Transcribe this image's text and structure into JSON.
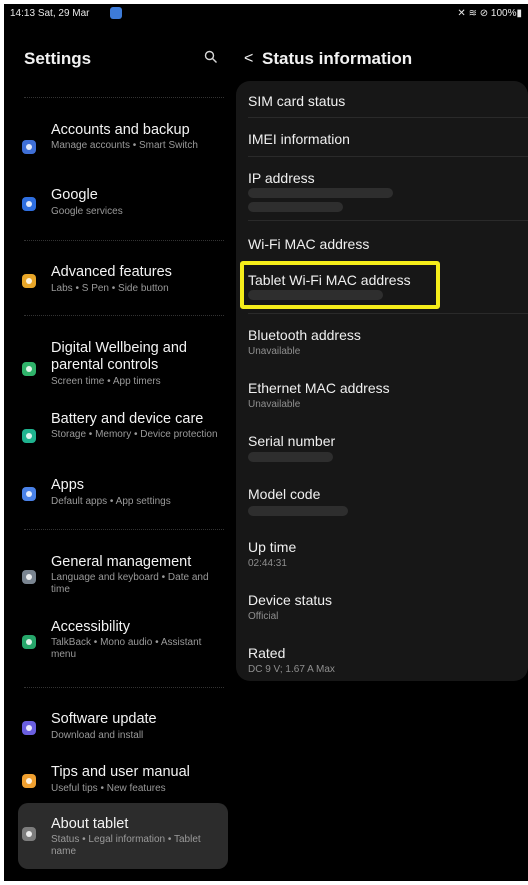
{
  "status_bar": {
    "time": "14:13",
    "date": "Sat, 29 Mar",
    "battery": "100%"
  },
  "left": {
    "title": "Settings",
    "items": [
      {
        "title": "Accounts and backup",
        "subtitle": "Manage accounts • Smart Switch",
        "color": "#3f6fd6"
      },
      {
        "title": "Google",
        "subtitle": "Google services",
        "color": "#2f6fe0"
      },
      {
        "title": "Advanced features",
        "subtitle": "Labs • S Pen • Side button",
        "color": "#e8a628"
      },
      {
        "title": "Digital Wellbeing and parental controls",
        "subtitle": "Screen time • App timers",
        "color": "#2fb36a"
      },
      {
        "title": "Battery and device care",
        "subtitle": "Storage • Memory • Device protection",
        "color": "#1fb38f"
      },
      {
        "title": "Apps",
        "subtitle": "Default apps • App settings",
        "color": "#4a82e8"
      },
      {
        "title": "General management",
        "subtitle": "Language and keyboard • Date and time",
        "color": "#7a8591"
      },
      {
        "title": "Accessibility",
        "subtitle": "TalkBack • Mono audio • Assistant menu",
        "color": "#26a66a"
      },
      {
        "title": "Software update",
        "subtitle": "Download and install",
        "color": "#6a5fe0"
      },
      {
        "title": "Tips and user manual",
        "subtitle": "Useful tips • New features",
        "color": "#f0a030"
      },
      {
        "title": "About tablet",
        "subtitle": "Status • Legal information • Tablet name",
        "color": "#7d7d7d"
      }
    ]
  },
  "right": {
    "title": "Status information",
    "rows": [
      {
        "title": "SIM card status",
        "subtitle": ""
      },
      {
        "title": "IMEI information",
        "subtitle": ""
      },
      {
        "title": "IP address",
        "subtitle": ""
      },
      {
        "title": "Wi-Fi MAC address",
        "subtitle": ""
      },
      {
        "title": "Tablet Wi-Fi MAC address",
        "subtitle": ""
      },
      {
        "title": "Bluetooth address",
        "subtitle": "Unavailable"
      },
      {
        "title": "Ethernet MAC address",
        "subtitle": "Unavailable"
      },
      {
        "title": "Serial number",
        "subtitle": ""
      },
      {
        "title": "Model code",
        "subtitle": ""
      },
      {
        "title": "Up time",
        "subtitle": "02:44:31"
      },
      {
        "title": "Device status",
        "subtitle": "Official"
      },
      {
        "title": "Rated",
        "subtitle": "DC 9 V; 1.67 A Max"
      }
    ]
  },
  "colors": {
    "highlight": "#f5ed1a",
    "panel": "#171717",
    "active_item": "#2c2c2c"
  }
}
